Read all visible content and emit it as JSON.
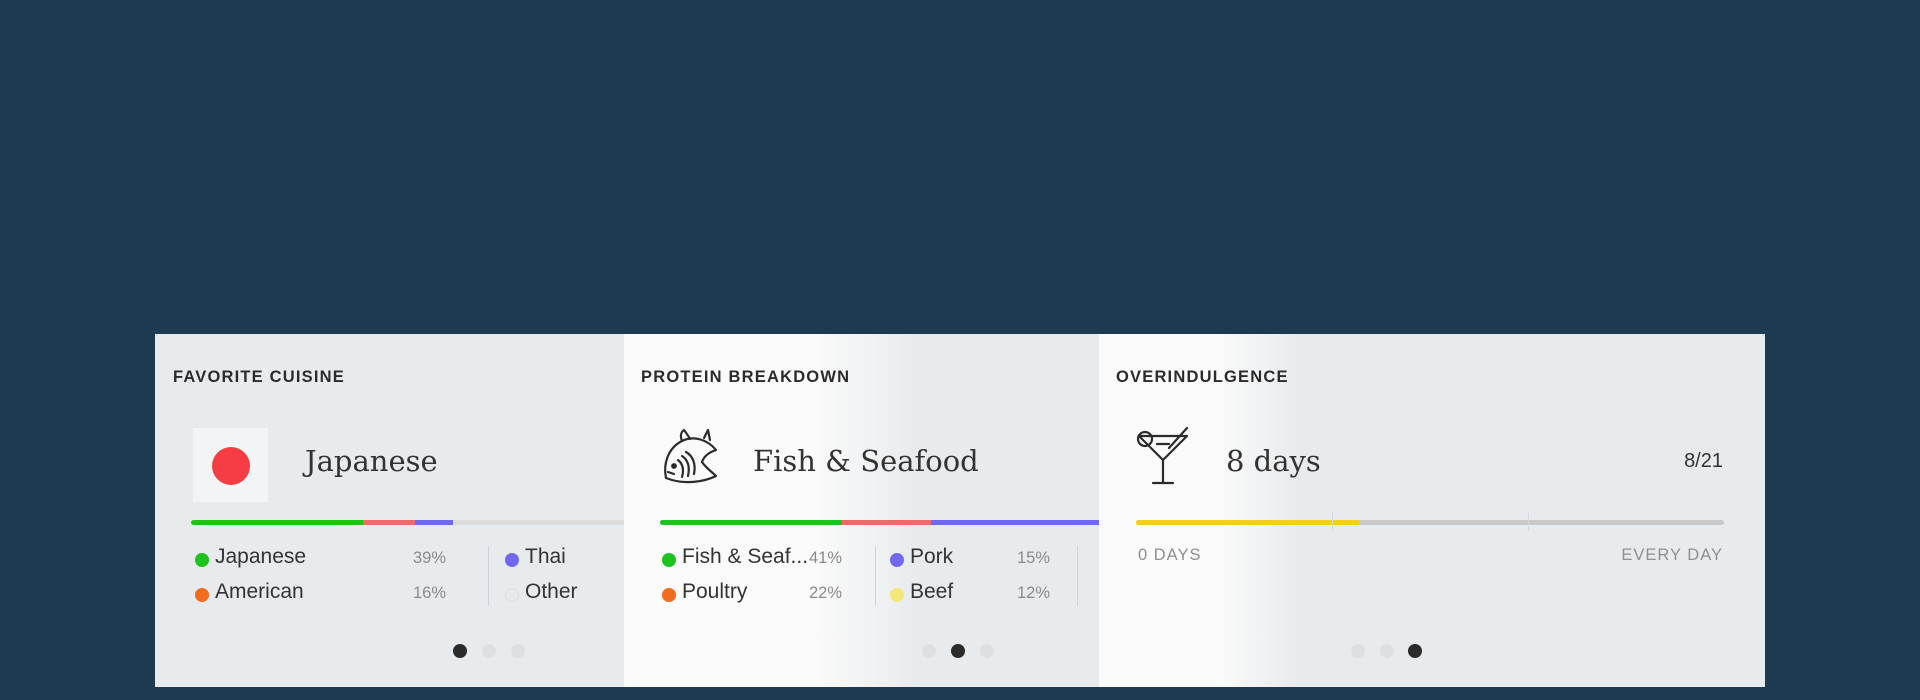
{
  "colors": {
    "green": "#1ec21e",
    "red": "#ef6b6b",
    "purple": "#7068ee",
    "orange": "#f36b1d",
    "yellow": "#f6e67a",
    "gold": "#f4cf1a",
    "gray": "#c9c9c9",
    "japan_red": "#f63d44"
  },
  "cuisine": {
    "title": "FAVORITE CUISINE",
    "headline": "Japanese",
    "icon": "japan-flag-icon",
    "bar": [
      {
        "color": "#1ec21e",
        "fraction": 0.39
      },
      {
        "color": "#ef6b6b",
        "fraction": 0.12
      },
      {
        "color": "#7068ee",
        "fraction": 0.085
      },
      {
        "color": "#dcdcdc",
        "fraction": 0.405
      }
    ],
    "legend": [
      {
        "label": "Japanese",
        "pct": "39%",
        "color": "#1ec21e"
      },
      {
        "label": "American",
        "pct": "16%",
        "color": "#f36b1d"
      },
      {
        "label": "Thai",
        "pct": "",
        "color": "#7068ee"
      },
      {
        "label": "Other",
        "pct": "",
        "color": "#e8ebee"
      }
    ],
    "page_index": 0
  },
  "protein": {
    "title": "PROTEIN BREAKDOWN",
    "headline": "Fish & Seafood",
    "icon": "fish-icon",
    "bar": [
      {
        "color": "#1ec21e",
        "fraction": 0.41
      },
      {
        "color": "#ef6b6b",
        "fraction": 0.2
      },
      {
        "color": "#7068ee",
        "fraction": 0.39
      }
    ],
    "legend": [
      {
        "label": "Fish & Seaf...",
        "pct": "41%",
        "color": "#1ec21e"
      },
      {
        "label": "Poultry",
        "pct": "22%",
        "color": "#f36b1d"
      },
      {
        "label": "Pork",
        "pct": "15%",
        "color": "#7068ee"
      },
      {
        "label": "Beef",
        "pct": "12%",
        "color": "#f6e67a"
      }
    ],
    "page_index": 1
  },
  "overindulgence": {
    "title": "OVERINDULGENCE",
    "headline": "8 days",
    "icon": "cocktail-icon",
    "ratio": "8/21",
    "progress_fraction": 0.38,
    "min_label": "0 DAYS",
    "max_label": "EVERY DAY",
    "page_index": 2
  },
  "pager_count": 3
}
